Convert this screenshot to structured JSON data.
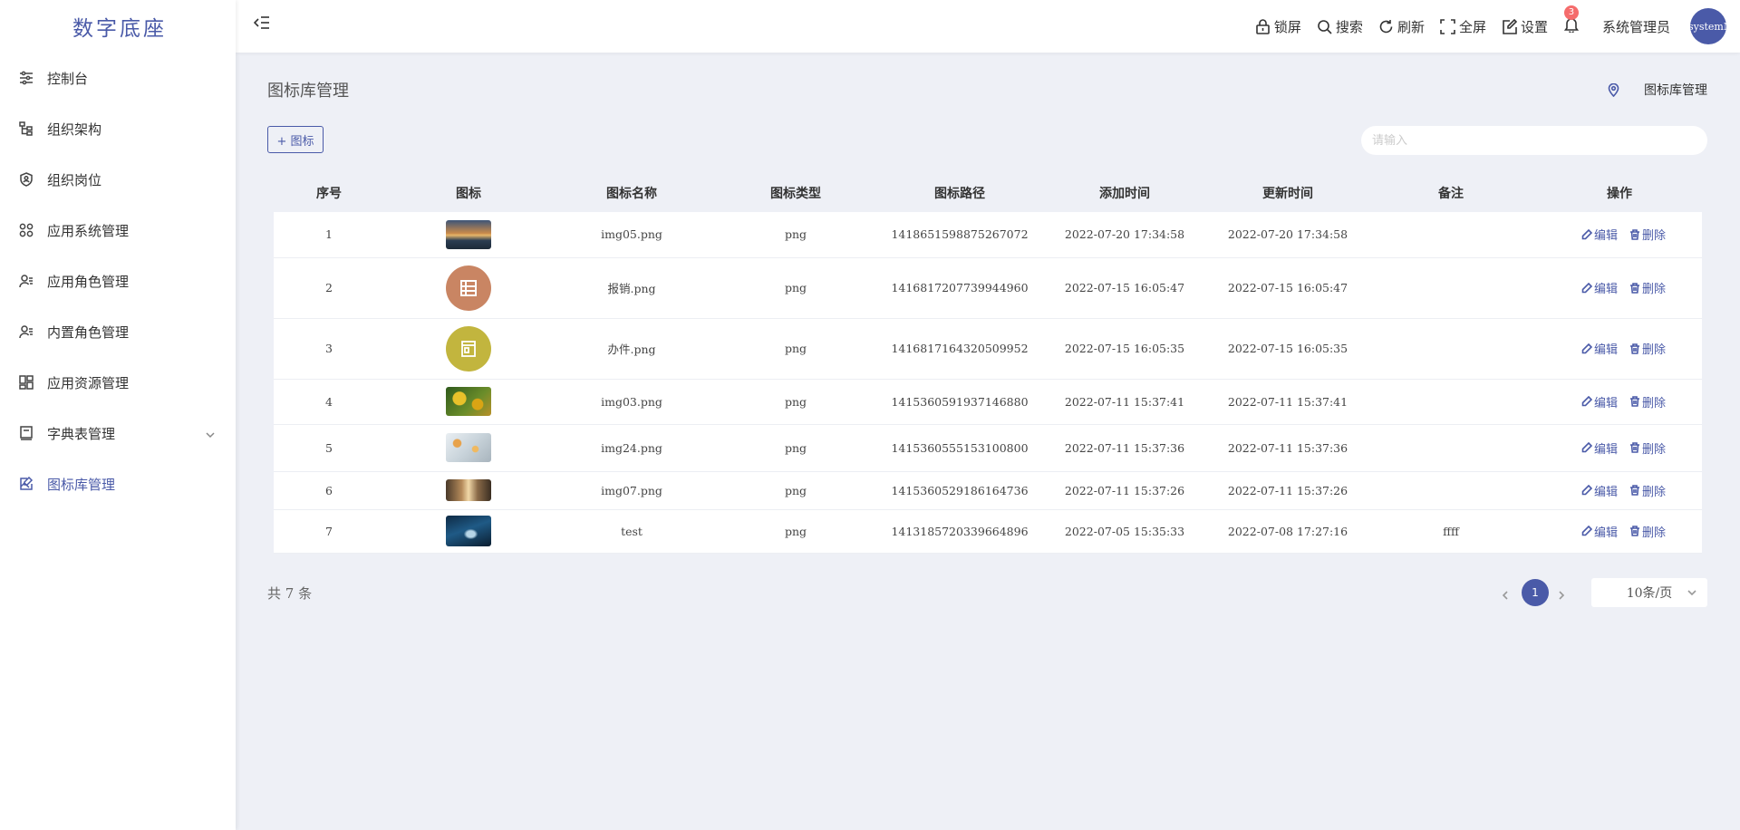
{
  "app": {
    "logo": "数字底座"
  },
  "sidebar": {
    "items": [
      {
        "label": "控制台",
        "icon": "sliders-icon"
      },
      {
        "label": "组织架构",
        "icon": "tree-icon"
      },
      {
        "label": "组织岗位",
        "icon": "shield-user-icon"
      },
      {
        "label": "应用系统管理",
        "icon": "grid-circles-icon"
      },
      {
        "label": "应用角色管理",
        "icon": "user-list-icon"
      },
      {
        "label": "内置角色管理",
        "icon": "user-list-icon"
      },
      {
        "label": "应用资源管理",
        "icon": "dashboard-icon"
      },
      {
        "label": "字典表管理",
        "icon": "book-icon"
      },
      {
        "label": "图标库管理",
        "icon": "image-edit-icon",
        "active": true
      }
    ]
  },
  "header": {
    "lock": "锁屏",
    "search": "搜索",
    "refresh": "刷新",
    "fullscreen": "全屏",
    "settings": "设置",
    "notifications": "3",
    "username": "系统管理员",
    "avatar_text": "systemMan"
  },
  "page": {
    "title": "图标库管理",
    "breadcrumb": "图标库管理",
    "add_button": "+ 图标",
    "search_placeholder": "请输入"
  },
  "table": {
    "columns": [
      "序号",
      "图标",
      "图标名称",
      "图标类型",
      "图标路径",
      "添加时间",
      "更新时间",
      "备注",
      "操作"
    ],
    "rows": [
      {
        "no": "1",
        "name": "img05.png",
        "type": "png",
        "path": "1418651598875267072",
        "added": "2022-07-20 17:34:58",
        "updated": "2022-07-20 17:34:58",
        "note": ""
      },
      {
        "no": "2",
        "name": "报销.png",
        "type": "png",
        "path": "1416817207739944960",
        "added": "2022-07-15 16:05:47",
        "updated": "2022-07-15 16:05:47",
        "note": ""
      },
      {
        "no": "3",
        "name": "办件.png",
        "type": "png",
        "path": "1416817164320509952",
        "added": "2022-07-15 16:05:35",
        "updated": "2022-07-15 16:05:35",
        "note": ""
      },
      {
        "no": "4",
        "name": "img03.png",
        "type": "png",
        "path": "1415360591937146880",
        "added": "2022-07-11 15:37:41",
        "updated": "2022-07-11 15:37:41",
        "note": ""
      },
      {
        "no": "5",
        "name": "img24.png",
        "type": "png",
        "path": "1415360555153100800",
        "added": "2022-07-11 15:37:36",
        "updated": "2022-07-11 15:37:36",
        "note": ""
      },
      {
        "no": "6",
        "name": "img07.png",
        "type": "png",
        "path": "1415360529186164736",
        "added": "2022-07-11 15:37:26",
        "updated": "2022-07-11 15:37:26",
        "note": ""
      },
      {
        "no": "7",
        "name": "test",
        "type": "png",
        "path": "1413185720339664896",
        "added": "2022-07-05 15:35:33",
        "updated": "2022-07-08 17:27:16",
        "note": "ffff"
      }
    ],
    "edit_label": "编辑",
    "delete_label": "删除"
  },
  "pagination": {
    "total": "共 7 条",
    "current": "1",
    "page_size": "10条/页"
  },
  "colors": {
    "accent": "#4a5aa8",
    "background": "#eef0f6",
    "badge": "#f56c6c"
  }
}
